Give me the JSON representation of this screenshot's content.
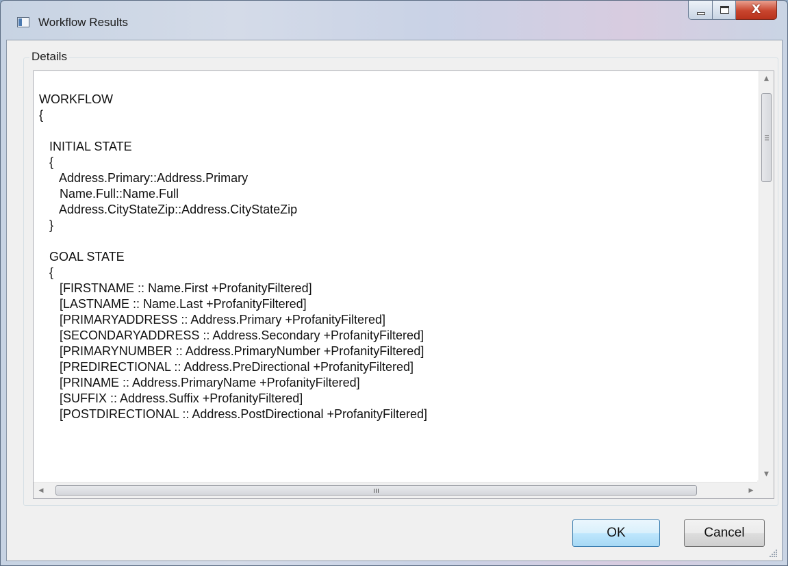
{
  "window": {
    "title": "Workflow Results",
    "close_glyph": "X"
  },
  "details": {
    "group_label": "Details",
    "lines": [
      "WORKFLOW",
      "{",
      "",
      "   INITIAL STATE",
      "   {",
      "      Address.Primary::Address.Primary",
      "      Name.Full::Name.Full",
      "      Address.CityStateZip::Address.CityStateZip",
      "   }",
      "",
      "   GOAL STATE",
      "   {",
      "      [FIRSTNAME :: Name.First +ProfanityFiltered]",
      "      [LASTNAME :: Name.Last +ProfanityFiltered]",
      "      [PRIMARYADDRESS :: Address.Primary +ProfanityFiltered]",
      "      [SECONDARYADDRESS :: Address.Secondary +ProfanityFiltered]",
      "      [PRIMARYNUMBER :: Address.PrimaryNumber +ProfanityFiltered]",
      "      [PREDIRECTIONAL :: Address.PreDirectional +ProfanityFiltered]",
      "      [PRINAME :: Address.PrimaryName +ProfanityFiltered]",
      "      [SUFFIX :: Address.Suffix +ProfanityFiltered]",
      "      [POSTDIRECTIONAL :: Address.PostDirectional +ProfanityFiltered]"
    ]
  },
  "buttons": {
    "ok": "OK",
    "cancel": "Cancel"
  },
  "icons": {
    "app": "window-app-icon",
    "minimize": "minimize-icon",
    "maximize": "maximize-icon",
    "close": "close-icon",
    "scroll_up": "scroll-up-arrow-icon",
    "scroll_down": "scroll-down-arrow-icon",
    "scroll_left": "scroll-left-arrow-icon",
    "scroll_right": "scroll-right-arrow-icon"
  },
  "colors": {
    "ok_button_accent": "#3c7fb1",
    "close_button": "#c8452e"
  }
}
